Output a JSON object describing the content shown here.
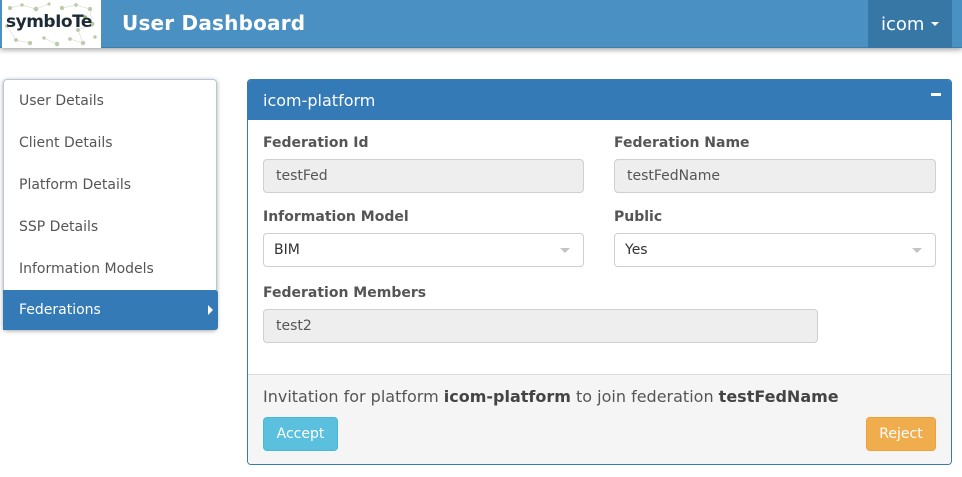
{
  "navbar": {
    "logo_text": "symbIoTe",
    "title": "User Dashboard",
    "user_menu_label": "icom",
    "brand_color": "#4a90c2"
  },
  "sidebar": {
    "items": [
      {
        "label": "User Details",
        "active": false
      },
      {
        "label": "Client Details",
        "active": false
      },
      {
        "label": "Platform Details",
        "active": false
      },
      {
        "label": "SSP Details",
        "active": false
      },
      {
        "label": "Information Models",
        "active": false
      },
      {
        "label": "Federations",
        "active": true
      }
    ],
    "active_color": "#337ab7"
  },
  "panel": {
    "title": "icom-platform",
    "collapse_icon": "minus-icon",
    "fields": {
      "federation_id": {
        "label": "Federation Id",
        "value": "testFed"
      },
      "federation_name": {
        "label": "Federation Name",
        "value": "testFedName"
      },
      "information_model": {
        "label": "Information Model",
        "value": "BIM"
      },
      "public": {
        "label": "Public",
        "value": "Yes"
      },
      "federation_members": {
        "label": "Federation Members",
        "value": "test2"
      }
    },
    "footer": {
      "invite_prefix": "Invitation for platform",
      "invite_platform": "icom-platform",
      "invite_middle": "to join federation",
      "invite_federation": "testFedName",
      "accept_label": "Accept",
      "reject_label": "Reject",
      "accept_color": "#5bc0de",
      "reject_color": "#f0ad4e"
    }
  }
}
